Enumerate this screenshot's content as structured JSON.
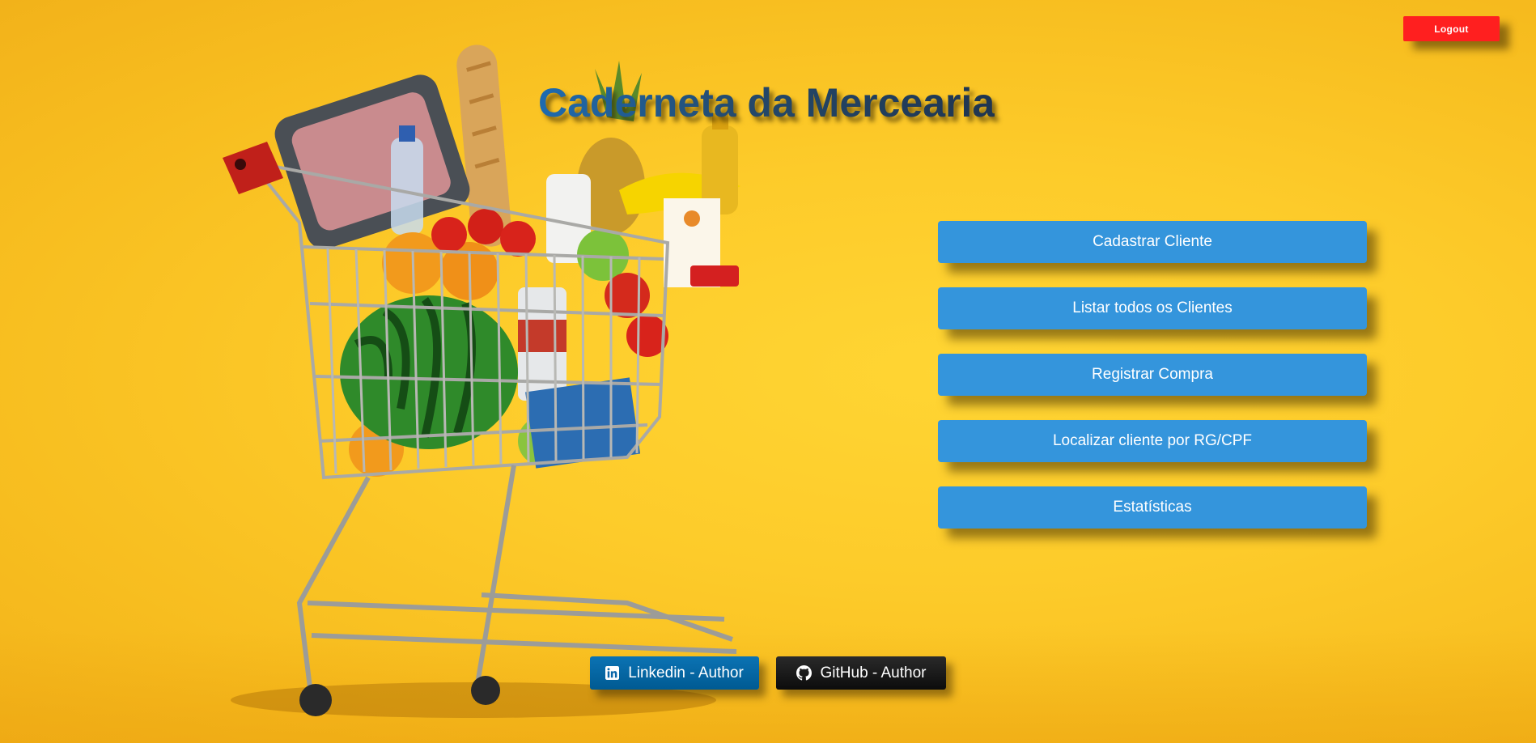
{
  "header": {
    "title": "Caderneta da Mercearia",
    "logout_label": "Logout"
  },
  "menu": {
    "items": [
      {
        "label": "Cadastrar Cliente"
      },
      {
        "label": "Listar todos os Clientes"
      },
      {
        "label": "Registrar Compra"
      },
      {
        "label": "Localizar cliente por RG/CPF"
      },
      {
        "label": "Estatísticas"
      }
    ]
  },
  "footer": {
    "linkedin": {
      "label": "Linkedin - Author",
      "icon": "linkedin-icon"
    },
    "github": {
      "label": "GitHub - Author",
      "icon": "github-icon"
    }
  },
  "colors": {
    "background": "#fdcb2a",
    "menu_button": "#3495dc",
    "logout_button": "#ff1f1f",
    "linkedin": "#0a66a8",
    "github": "#111111",
    "title": "#24496b"
  }
}
